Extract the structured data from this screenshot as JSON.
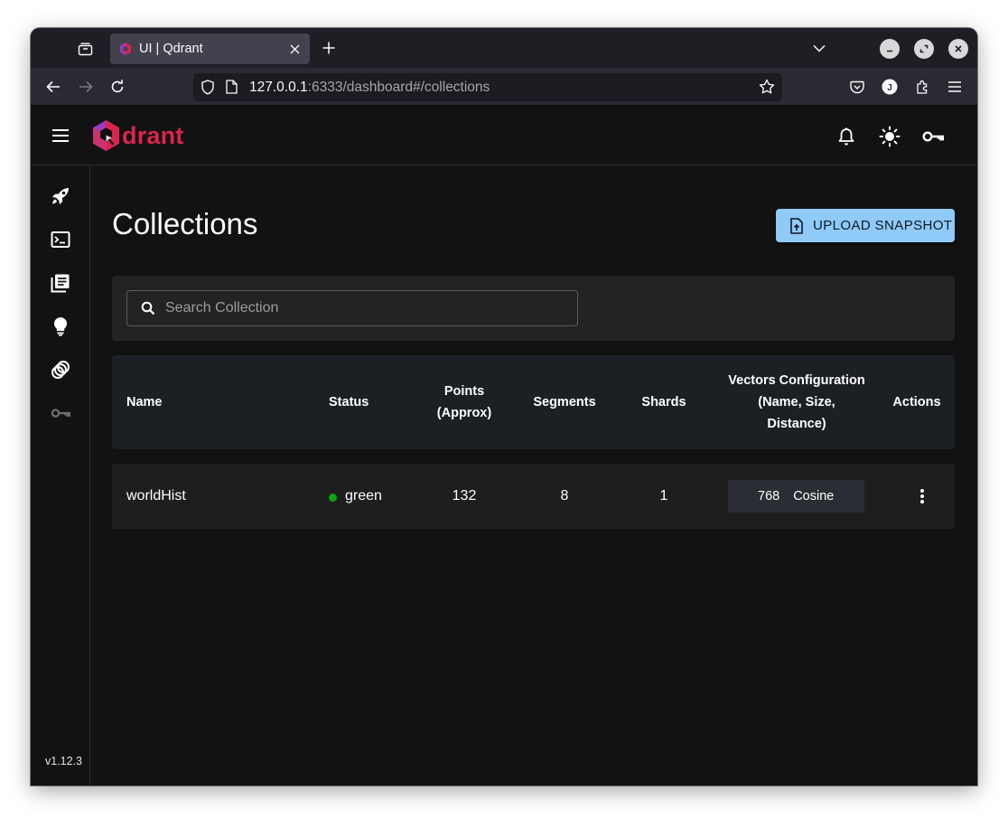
{
  "browser": {
    "tab_title": "UI | Qdrant",
    "url_host": "127.0.0.1",
    "url_rest": ":6333/dashboard#/collections"
  },
  "app": {
    "logo_text": "drant",
    "version": "v1.12.3",
    "brand_color": "#dc244c",
    "sidebar_items": [
      "rocket-icon",
      "console-icon",
      "collections-icon",
      "lightbulb-icon",
      "datasets-icon",
      "access-key-icon"
    ]
  },
  "page": {
    "title": "Collections",
    "upload_label": "UPLOAD SNAPSHOT",
    "search_placeholder": "Search Collection"
  },
  "table": {
    "headers": {
      "name": "Name",
      "status": "Status",
      "points_1": "Points",
      "points_2": "(Approx)",
      "segments": "Segments",
      "shards": "Shards",
      "vectors_1": "Vectors Configuration",
      "vectors_2": "(Name, Size,",
      "vectors_3": "Distance)",
      "actions": "Actions"
    },
    "rows": [
      {
        "name": "worldHist",
        "status": "green",
        "points": "132",
        "segments": "8",
        "shards": "1",
        "vector_size": "768",
        "vector_distance": "Cosine"
      }
    ]
  }
}
